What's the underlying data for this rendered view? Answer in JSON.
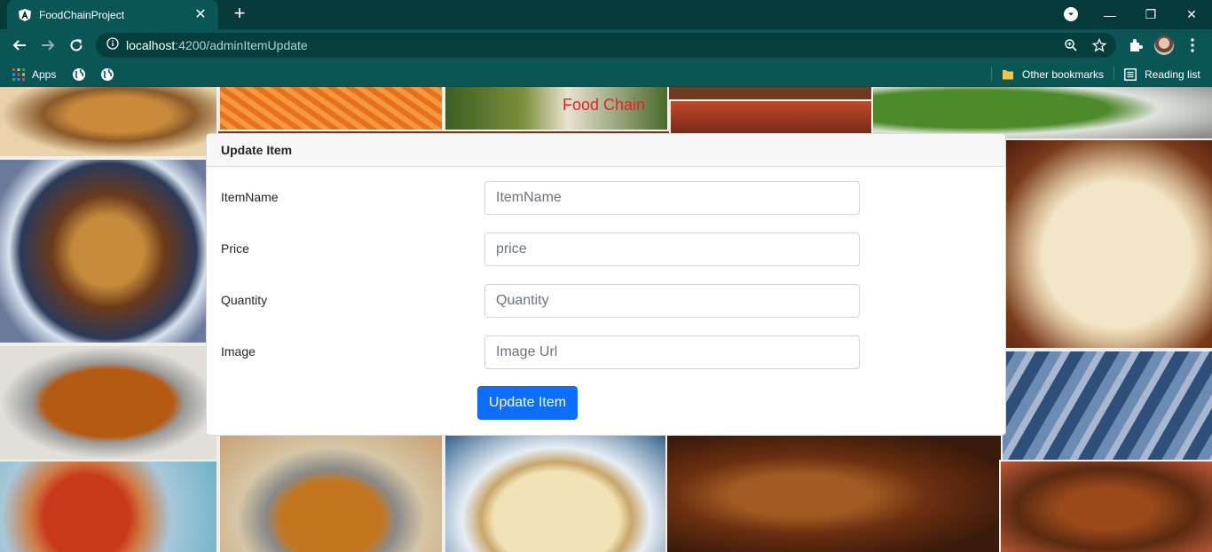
{
  "browser": {
    "tab_title": "FoodChainProject",
    "tab_close": "✕",
    "new_tab": "+",
    "url_host": "localhost",
    "url_path": ":4200/adminItemUpdate",
    "bookmarks": {
      "apps_label": "Apps",
      "other_bookmarks": "Other bookmarks",
      "reading_list": "Reading list"
    },
    "window_controls": {
      "minimize": "—",
      "restore": "❐",
      "close": "✕"
    }
  },
  "page": {
    "site_title": "Food Chain",
    "card_title": "Update Item",
    "fields": [
      {
        "label": "ItemName",
        "placeholder": "ItemName"
      },
      {
        "label": "Price",
        "placeholder": "price"
      },
      {
        "label": "Quantity",
        "placeholder": "Quantity"
      },
      {
        "label": "Image",
        "placeholder": "Image Url"
      }
    ],
    "submit_label": "Update Item"
  },
  "colors": {
    "chrome_dark": "#053a3a",
    "chrome": "#0a5656",
    "site_title": "#e4212b",
    "primary_button": "#0d6efd"
  }
}
